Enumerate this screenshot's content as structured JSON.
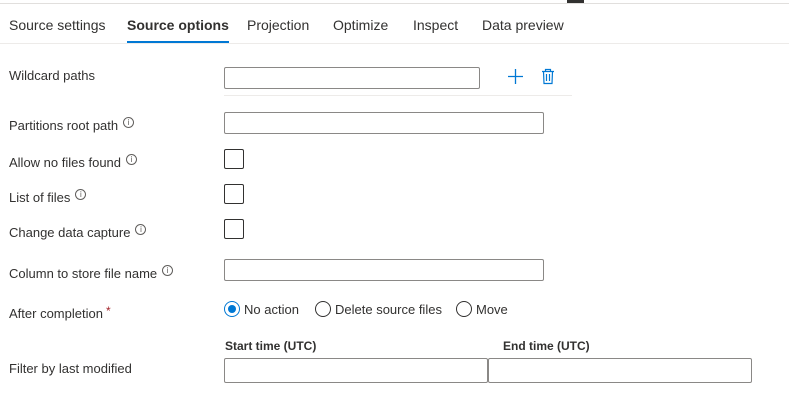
{
  "tabs": [
    {
      "label": "Source settings",
      "active": false
    },
    {
      "label": "Source options",
      "active": true
    },
    {
      "label": "Projection",
      "active": false
    },
    {
      "label": "Optimize",
      "active": false
    },
    {
      "label": "Inspect",
      "active": false
    },
    {
      "label": "Data preview",
      "active": false
    }
  ],
  "form": {
    "wildcard_paths": {
      "label": "Wildcard paths",
      "value": ""
    },
    "partitions_root_path": {
      "label": "Partitions root path",
      "value": ""
    },
    "allow_no_files_found": {
      "label": "Allow no files found",
      "checked": false
    },
    "list_of_files": {
      "label": "List of files",
      "checked": false
    },
    "change_data_capture": {
      "label": "Change data capture",
      "checked": false
    },
    "column_to_store_file_name": {
      "label": "Column to store file name",
      "value": ""
    },
    "after_completion": {
      "label": "After completion",
      "required_marker": "*",
      "options": [
        "No action",
        "Delete source files",
        "Move"
      ],
      "selected": "No action"
    },
    "filter_by_last_modified": {
      "label": "Filter by last modified",
      "start_label": "Start time (UTC)",
      "end_label": "End time (UTC)",
      "start_value": "",
      "end_value": ""
    }
  },
  "info_glyph": "i",
  "colors": {
    "accent": "#0078d4",
    "required": "#a4262c",
    "text": "#323130"
  }
}
